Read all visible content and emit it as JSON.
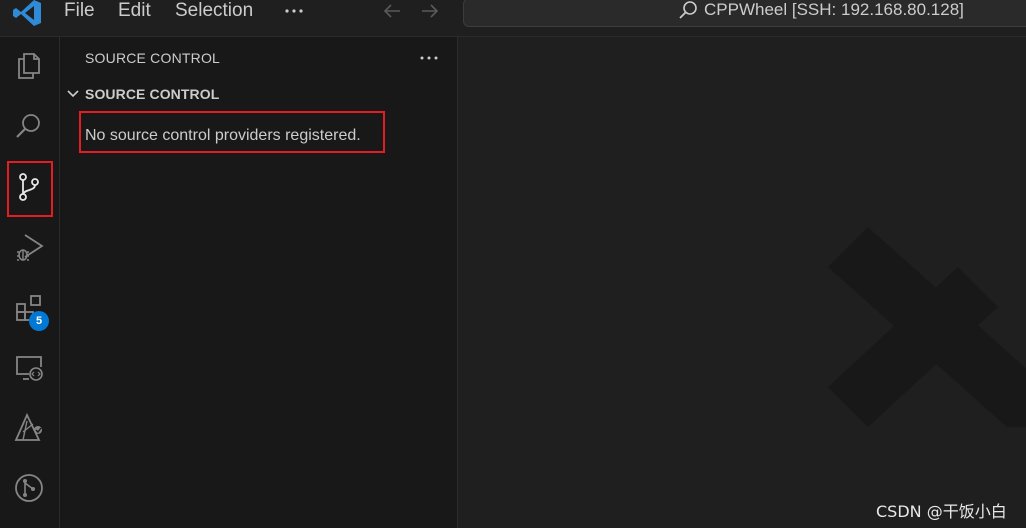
{
  "menu": {
    "file": "File",
    "edit": "Edit",
    "selection": "Selection"
  },
  "command_center": {
    "text": "CPPWheel [SSH: 192.168.80.128]"
  },
  "activity_bar": {
    "items": [
      {
        "icon": "files-icon"
      },
      {
        "icon": "search-icon"
      },
      {
        "icon": "source-control-icon",
        "active": true
      },
      {
        "icon": "run-debug-icon"
      },
      {
        "icon": "extensions-icon",
        "badge": "5"
      },
      {
        "icon": "remote-explorer-icon"
      },
      {
        "icon": "testing-icon"
      },
      {
        "icon": "git-graph-icon"
      }
    ]
  },
  "sidebar": {
    "title": "SOURCE CONTROL",
    "section_title": "SOURCE CONTROL",
    "message": "No source control providers registered."
  },
  "watermark": {
    "text": "CSDN @干饭小白"
  },
  "colors": {
    "accent": "#0078d4",
    "highlight_box": "#e21d24",
    "background": "#1f1f1f",
    "sidebar": "#181818",
    "logo_blue": "#2f8bd8"
  }
}
